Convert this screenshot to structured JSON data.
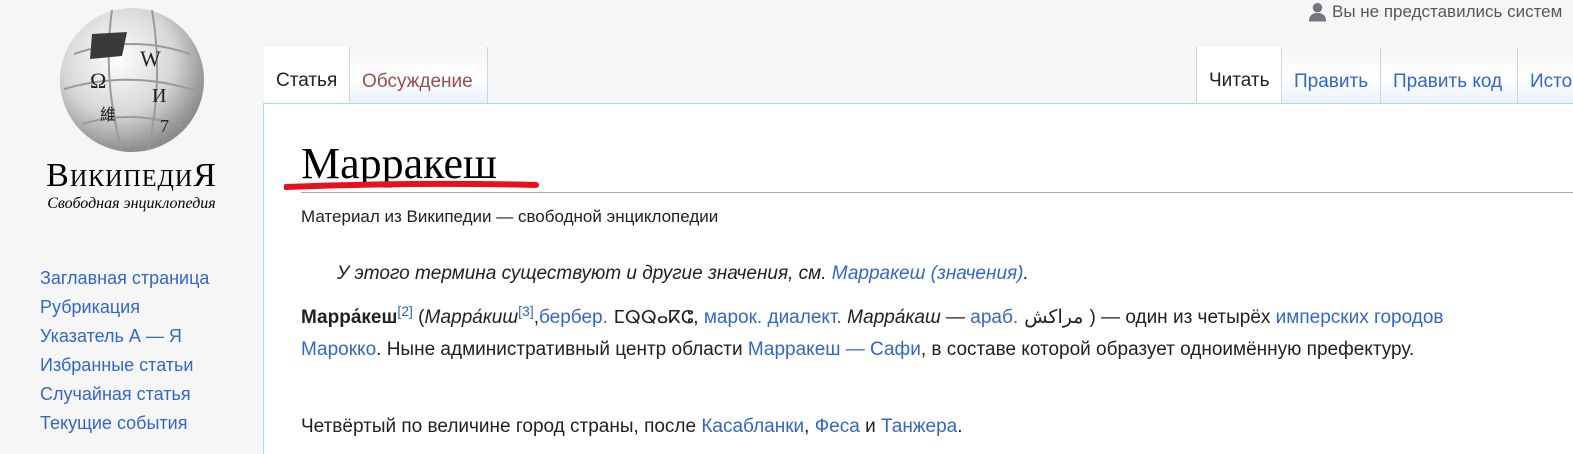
{
  "logo": {
    "wordmark_parts": [
      "В",
      "икипеди",
      "Я"
    ],
    "tagline": "Свободная энциклопедия",
    "globe_glyphs": [
      "W",
      "Ω",
      "И",
      "維",
      "7"
    ]
  },
  "sidebar": {
    "items": [
      {
        "label": "Заглавная страница"
      },
      {
        "label": "Рубрикация"
      },
      {
        "label": "Указатель А — Я"
      },
      {
        "label": "Избранные статьи"
      },
      {
        "label": "Случайная статья"
      },
      {
        "label": "Текущие события"
      }
    ]
  },
  "userbar": {
    "text": "Вы не представились систем"
  },
  "tabs": {
    "article": "Статья",
    "talk": "Обсуждение",
    "read": "Читать",
    "edit": "Править",
    "edit_source": "Править код",
    "history": "Исто"
  },
  "page": {
    "title": "Марракеш",
    "subtitle": "Материал из Википедии — свободной энциклопедии",
    "hatnote": {
      "text": "У этого термина существуют и другие значения, см. ",
      "link": "Марракеш (значения)",
      "end": "."
    },
    "para1": {
      "term": "Марра́кеш",
      "ref2": "[2]",
      "t1": " (",
      "alt1": "Марра́киш",
      "ref3": "[3]",
      "t2": ",",
      "link_berber": "бербер.",
      "berber": " ⵎⵕⵕⴰⴽⵛ",
      "t3": ", ",
      "link_dialect": "марок. диалект.",
      "alt2": " Марра́каш",
      "t4": " — ",
      "link_arab": "араб.",
      "arabic": " مراكش ",
      "t5": ") — один из четырёх ",
      "link_imperial": "имперских городов Марокко",
      "t6": ". Ныне административный центр области ",
      "link_region": "Марракеш — Сафи",
      "t7": ", в составе которой образует одноимённую префектуру."
    },
    "para2": {
      "t1": "Четвёртый по величине город страны, после ",
      "link1": "Касабланки",
      "t2": ", ",
      "link2": "Феса",
      "t3": " и ",
      "link3": "Танжера",
      "t4": "."
    }
  },
  "colors": {
    "link": "#3366cc",
    "talk_tab": "#9a4f4f",
    "annotation_underline": "#e8101e",
    "content_border": "#a7d7f9"
  }
}
